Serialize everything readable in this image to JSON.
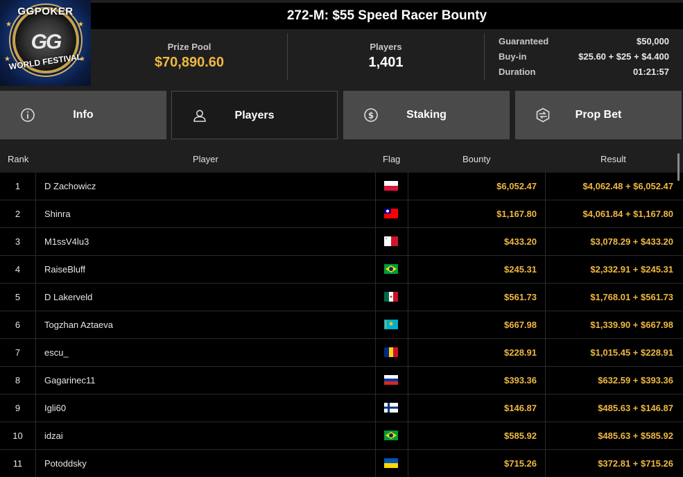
{
  "brand": {
    "top_text": "GGPOKER",
    "center_text": "GG",
    "bottom_text": "WORLD FESTIVAL"
  },
  "tournament": {
    "title": "272-M: $55 Speed Racer Bounty"
  },
  "stats": {
    "prize_pool_label": "Prize Pool",
    "prize_pool_value": "$70,890.60",
    "players_label": "Players",
    "players_value": "1,401"
  },
  "details": {
    "guaranteed_label": "Guaranteed",
    "guaranteed_value": "$50,000",
    "buyin_label": "Buy-in",
    "buyin_value": "$25.60 + $25 + $4.400",
    "duration_label": "Duration",
    "duration_value": "01:21:57"
  },
  "tabs": [
    {
      "label": "Info",
      "icon": "info-icon",
      "active": false
    },
    {
      "label": "Players",
      "icon": "user-icon",
      "active": true
    },
    {
      "label": "Staking",
      "icon": "dollar-coin-icon",
      "active": false
    },
    {
      "label": "Prop Bet",
      "icon": "prop-bet-icon",
      "active": false
    }
  ],
  "table": {
    "headers": {
      "rank": "Rank",
      "player": "Player",
      "flag": "Flag",
      "bounty": "Bounty",
      "result": "Result"
    },
    "rows": [
      {
        "rank": "1",
        "player": "D Zachowicz",
        "flag": "poland-flag",
        "bounty": "$6,052.47",
        "result": "$4,062.48 + $6,052.47"
      },
      {
        "rank": "2",
        "player": "Shinra",
        "flag": "taiwan-flag",
        "bounty": "$1,167.80",
        "result": "$4,061.84 + $1,167.80"
      },
      {
        "rank": "3",
        "player": "M1ssV4lu3",
        "flag": "malta-flag",
        "bounty": "$433.20",
        "result": "$3,078.29 + $433.20"
      },
      {
        "rank": "4",
        "player": "RaiseBluff",
        "flag": "brazil-flag",
        "bounty": "$245.31",
        "result": "$2,332.91 + $245.31"
      },
      {
        "rank": "5",
        "player": "D Lakerveld",
        "flag": "mexico-flag",
        "bounty": "$561.73",
        "result": "$1,768.01 + $561.73"
      },
      {
        "rank": "6",
        "player": "Togzhan Aztaeva",
        "flag": "kazakhstan-flag",
        "bounty": "$667.98",
        "result": "$1,339.90 + $667.98"
      },
      {
        "rank": "7",
        "player": "escu_",
        "flag": "romania-flag",
        "bounty": "$228.91",
        "result": "$1,015.45 + $228.91"
      },
      {
        "rank": "8",
        "player": "Gagarinec11",
        "flag": "russia-flag",
        "bounty": "$393.36",
        "result": "$632.59 + $393.36"
      },
      {
        "rank": "9",
        "player": "Igli60",
        "flag": "finland-flag",
        "bounty": "$146.87",
        "result": "$485.63 + $146.87"
      },
      {
        "rank": "10",
        "player": "idzai",
        "flag": "brazil-flag",
        "bounty": "$585.92",
        "result": "$485.63 + $585.92"
      },
      {
        "rank": "11",
        "player": "Potoddsky",
        "flag": "ukraine-flag",
        "bounty": "$715.26",
        "result": "$372.81 + $715.26"
      }
    ]
  },
  "colors": {
    "gold": "#f0b840",
    "panel": "#1f1f1f",
    "tab_inactive": "#4a4a4a",
    "background": "#000000"
  }
}
